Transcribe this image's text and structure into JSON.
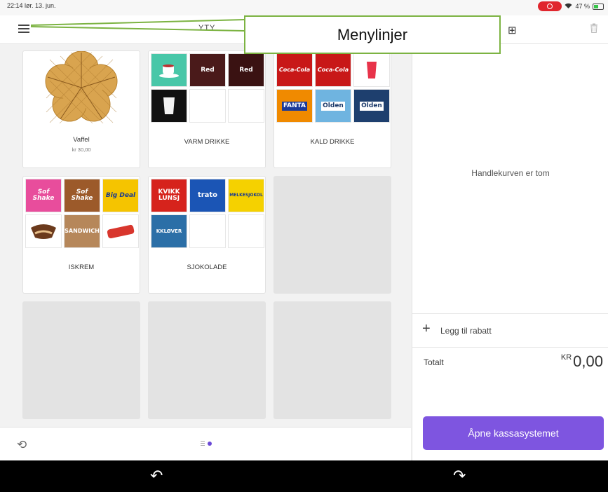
{
  "status": {
    "time_date": "22:14  lør. 13. jun.",
    "battery": "47 %"
  },
  "header": {
    "title": "YTY",
    "table_icon": "⊞"
  },
  "tiles": [
    {
      "label": "Vaffel",
      "price": "kr 30,00"
    },
    {
      "label": "VARM DRIKKE",
      "thumbs": [
        "",
        "Red",
        "Red",
        "",
        "",
        ""
      ]
    },
    {
      "label": "KALD DRIKKE",
      "thumbs": [
        "Coca-Cola",
        "Coca-Cola",
        "",
        "FANTA",
        "Olden",
        "Olden"
      ]
    },
    {
      "label": "ISKREM",
      "thumbs": [
        "Sof Shake",
        "Sof Shake",
        "Big Deal",
        "",
        "SANDWICH",
        ""
      ]
    },
    {
      "label": "SJOKOLADE",
      "thumbs": [
        "KVIKK LUNSJ",
        "trato",
        "MELKESJOKOL",
        "KKLØVER",
        "",
        ""
      ]
    }
  ],
  "cart": {
    "empty_message": "Handlekurven er tom",
    "discount_label": "Legg til rabatt",
    "total_label": "Totalt",
    "currency": "KR",
    "total_value": "0,00",
    "checkout_label": "Åpne kassasystemet"
  },
  "annotation": {
    "text": "Menylinjer",
    "border_color": "#7cb342"
  },
  "colors": {
    "accent": "#7e55e0",
    "pager_active": "#6a49d6"
  }
}
